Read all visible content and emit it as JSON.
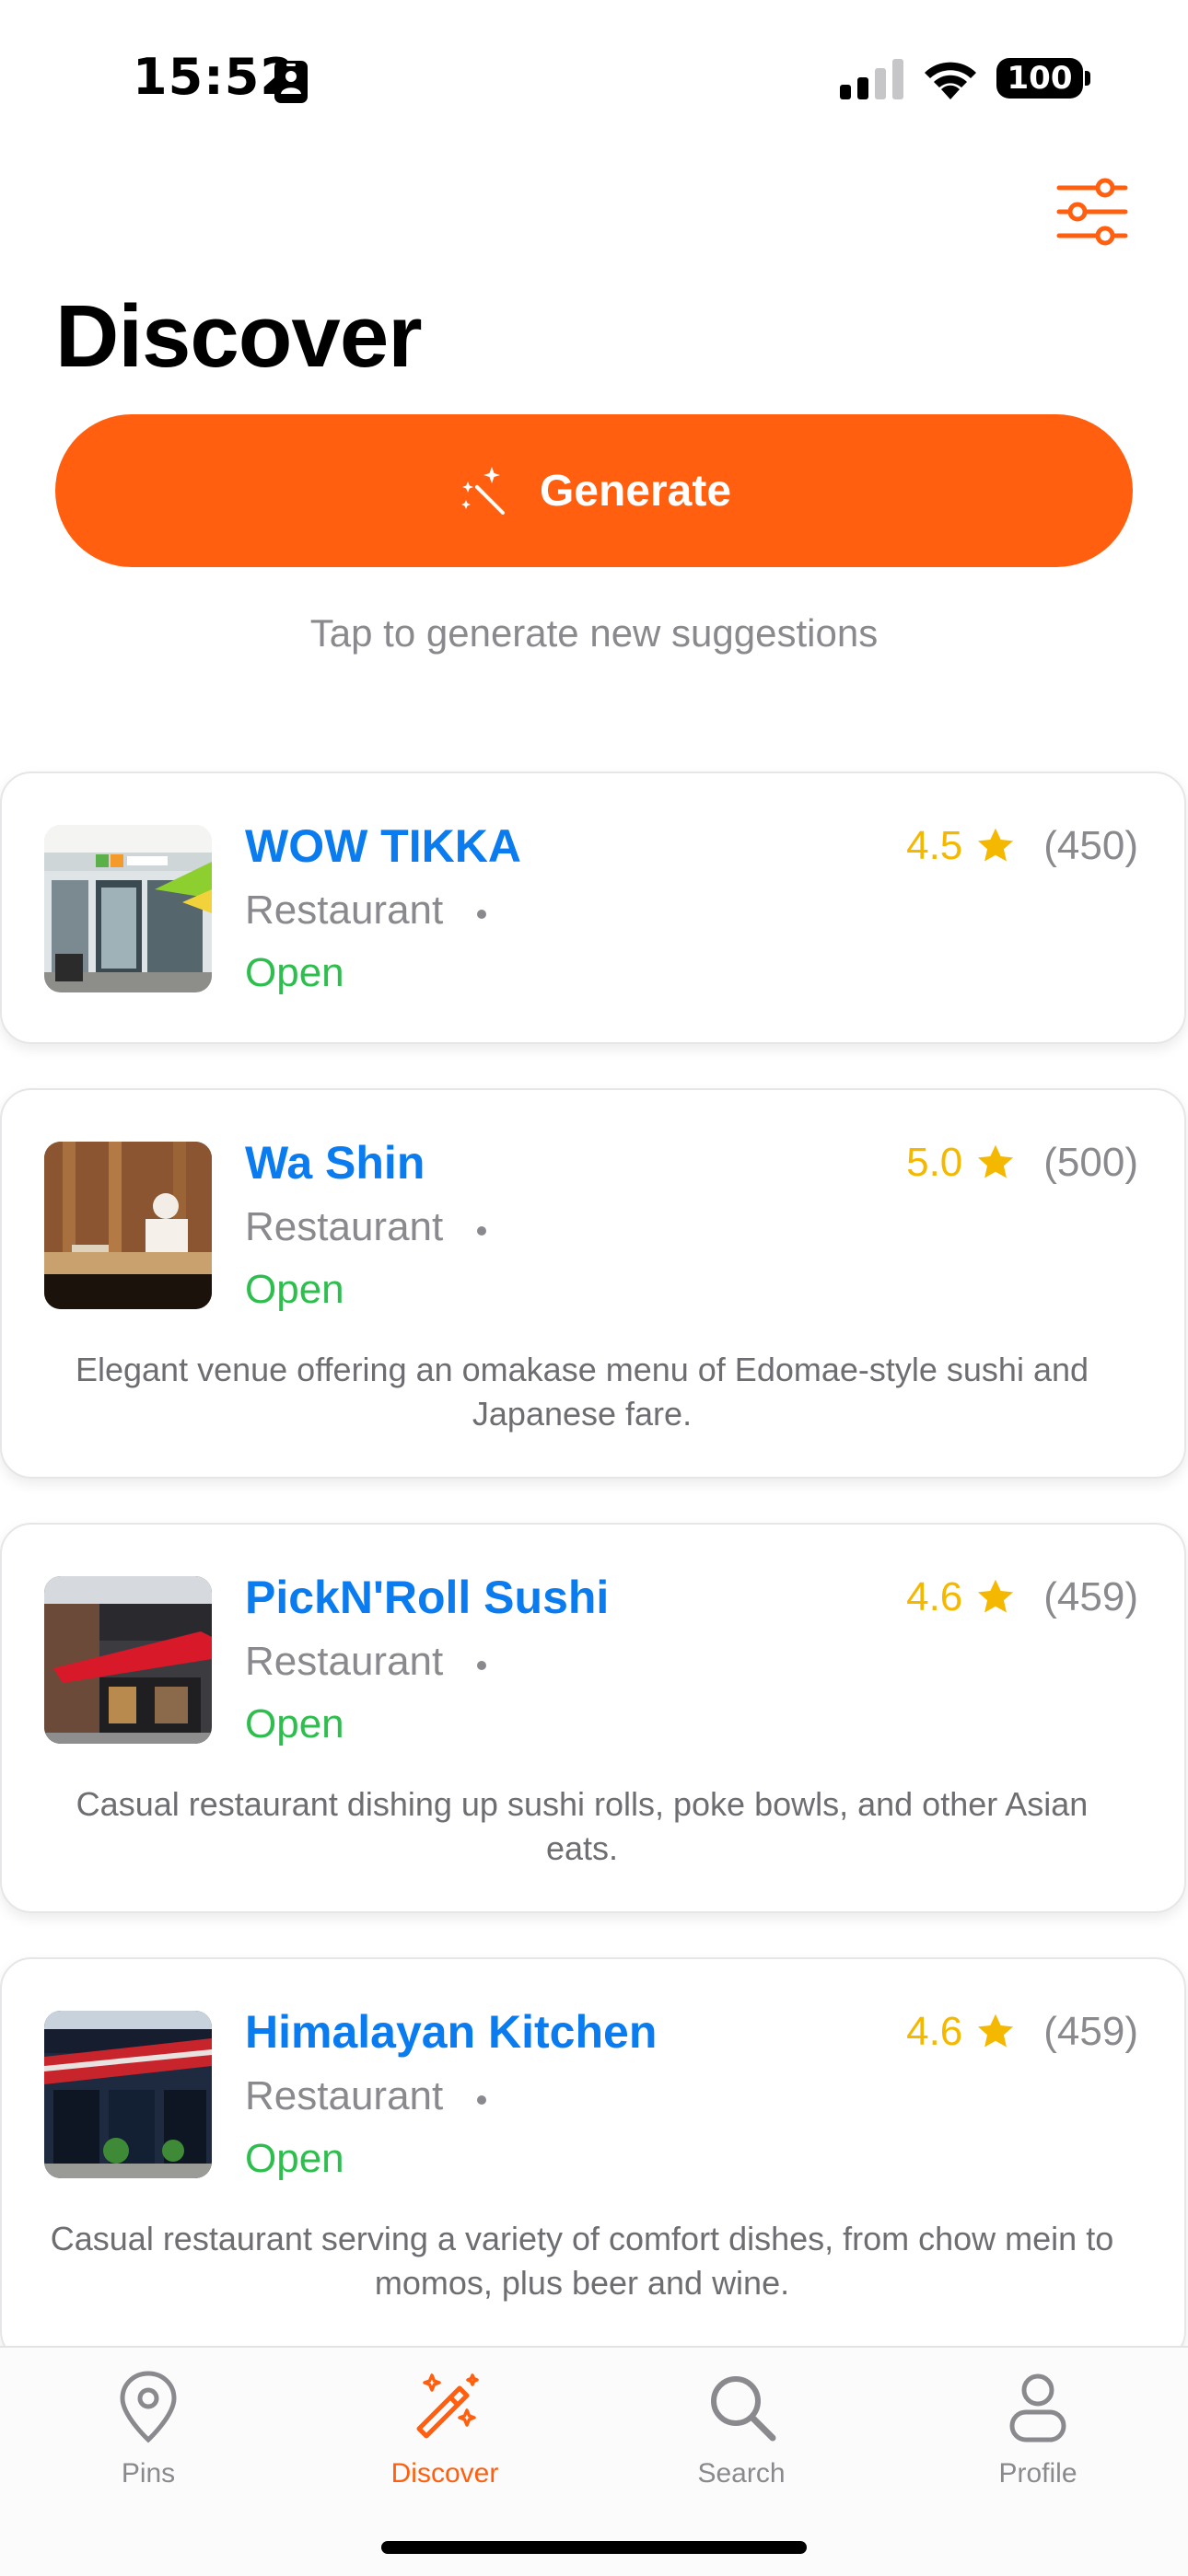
{
  "status_bar": {
    "time": "15:52",
    "battery": "100"
  },
  "header": {
    "title": "Discover",
    "filter_icon": "sliders-icon"
  },
  "generate": {
    "label": "Generate",
    "icon": "magic-wand-icon",
    "hint": "Tap to generate new suggestions"
  },
  "colors": {
    "accent": "#FF5F0F",
    "link": "#0A7CF0",
    "rating": "#F5B800",
    "open": "#2DBE4E",
    "muted": "#8a8a8e"
  },
  "places": [
    {
      "name": "WOW TIKKA",
      "rating": "4.5",
      "reviews": "(450)",
      "type": "Restaurant",
      "status": "Open",
      "description": ""
    },
    {
      "name": "Wa Shin",
      "rating": "5.0",
      "reviews": "(500)",
      "type": "Restaurant",
      "status": "Open",
      "description": "Elegant venue offering an omakase menu of Edomae-style sushi and Japanese fare."
    },
    {
      "name": "PickN'Roll Sushi",
      "rating": "4.6",
      "reviews": "(459)",
      "type": "Restaurant",
      "status": "Open",
      "description": "Casual restaurant dishing up sushi rolls, poke bowls, and other Asian eats."
    },
    {
      "name": "Himalayan Kitchen",
      "rating": "4.6",
      "reviews": "(459)",
      "type": "Restaurant",
      "status": "Open",
      "description": "Casual restaurant serving a variety of comfort dishes, from chow mein to momos, plus beer and wine."
    }
  ],
  "tabs": [
    {
      "label": "Pins",
      "icon": "map-pin-icon",
      "active": false
    },
    {
      "label": "Discover",
      "icon": "magic-wand-icon",
      "active": true
    },
    {
      "label": "Search",
      "icon": "search-icon",
      "active": false
    },
    {
      "label": "Profile",
      "icon": "person-icon",
      "active": false
    }
  ]
}
